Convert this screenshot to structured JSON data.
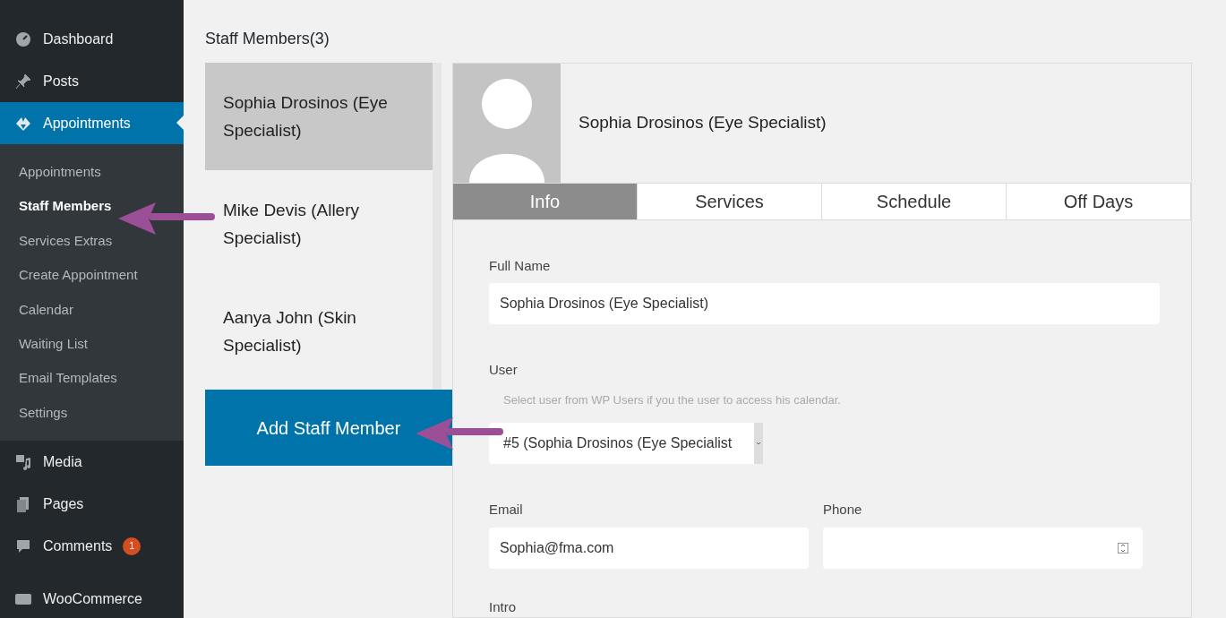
{
  "sidebar": {
    "items": [
      {
        "label": "Dashboard",
        "selected": false
      },
      {
        "label": "Posts",
        "selected": false
      },
      {
        "label": "Appointments",
        "selected": true,
        "children": [
          {
            "label": "Appointments",
            "selected": false
          },
          {
            "label": "Staff Members",
            "selected": true
          },
          {
            "label": "Services Extras",
            "selected": false
          },
          {
            "label": "Create Appointment",
            "selected": false
          },
          {
            "label": "Calendar",
            "selected": false
          },
          {
            "label": "Waiting List",
            "selected": false
          },
          {
            "label": "Email Templates",
            "selected": false
          },
          {
            "label": "Settings",
            "selected": false
          }
        ]
      },
      {
        "label": "Media",
        "selected": false
      },
      {
        "label": "Pages",
        "selected": false
      },
      {
        "label": "Comments",
        "selected": false,
        "badge": "1"
      },
      {
        "label": "WooCommerce",
        "selected": false
      }
    ]
  },
  "page_title": "Staff Members(3)",
  "staff_list": [
    {
      "name": "Sophia Drosinos (Eye Specialist)",
      "selected": true
    },
    {
      "name": "Mike Devis (Allery Specialist)",
      "selected": false
    },
    {
      "name": "Aanya John (Skin Specialist)",
      "selected": false
    }
  ],
  "add_button": "Add Staff Member",
  "profile": {
    "name": "Sophia Drosinos (Eye Specialist)"
  },
  "tabs": [
    {
      "label": "Info",
      "selected": true
    },
    {
      "label": "Services",
      "selected": false
    },
    {
      "label": "Schedule",
      "selected": false
    },
    {
      "label": "Off Days",
      "selected": false
    }
  ],
  "form": {
    "full_name": {
      "label": "Full Name",
      "value": "Sophia Drosinos (Eye Specialist)"
    },
    "user": {
      "label": "User",
      "hint": "Select user from WP Users if you the user to access his calendar.",
      "value": "#5 (Sophia Drosinos (Eye Specialist"
    },
    "email": {
      "label": "Email",
      "value": "Sophia@fma.com"
    },
    "phone": {
      "label": "Phone"
    },
    "intro": {
      "label": "Intro"
    }
  }
}
